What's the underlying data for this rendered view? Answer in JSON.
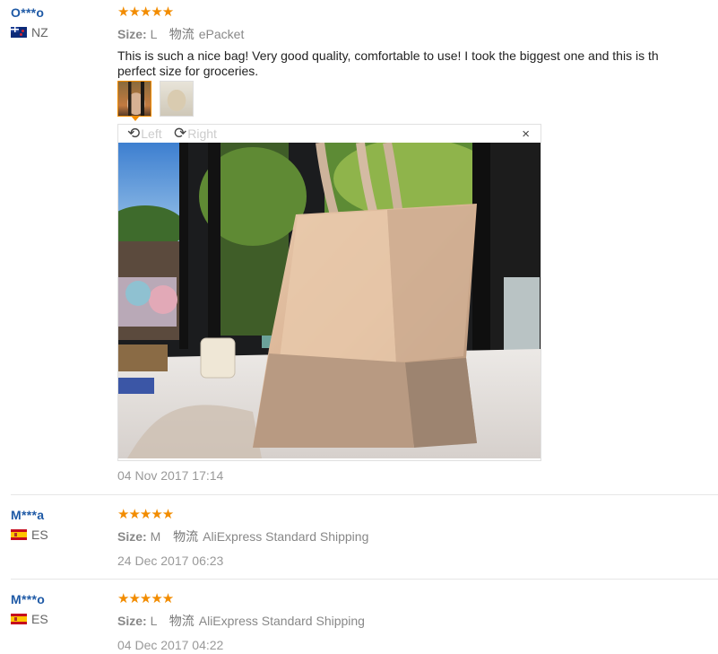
{
  "reviews": [
    {
      "user": "O***o",
      "country": "NZ",
      "stars": "★★★★★",
      "size_label": "Size:",
      "size_value": "L",
      "shipping_cn": "物流",
      "shipping": "ePacket",
      "text_line1": "This is such a nice bag! Very good quality, comfortable to use! I took the biggest one and this is th",
      "text_line2": "perfect size for groceries.",
      "date": "04 Nov 2017 17:14"
    },
    {
      "user": "M***a",
      "country": "ES",
      "stars": "★★★★★",
      "size_label": "Size:",
      "size_value": "M",
      "shipping_cn": "物流",
      "shipping": "AliExpress Standard Shipping",
      "date": "24 Dec 2017 06:23"
    },
    {
      "user": "M***o",
      "country": "ES",
      "stars": "★★★★★",
      "size_label": "Size:",
      "size_value": "L",
      "shipping_cn": "物流",
      "shipping": "AliExpress Standard Shipping",
      "date": "04 Dec 2017 04:22"
    }
  ],
  "viewer": {
    "rotate_left": "Left",
    "rotate_right": "Right",
    "close": "×",
    "icons": {
      "rotate_left": "rotate-left-icon",
      "rotate_right": "rotate-right-icon",
      "close": "close-icon"
    }
  },
  "colors": {
    "username": "#1f5aa6",
    "stars": "#f28c00",
    "thumb_selected": "#f28c00"
  }
}
